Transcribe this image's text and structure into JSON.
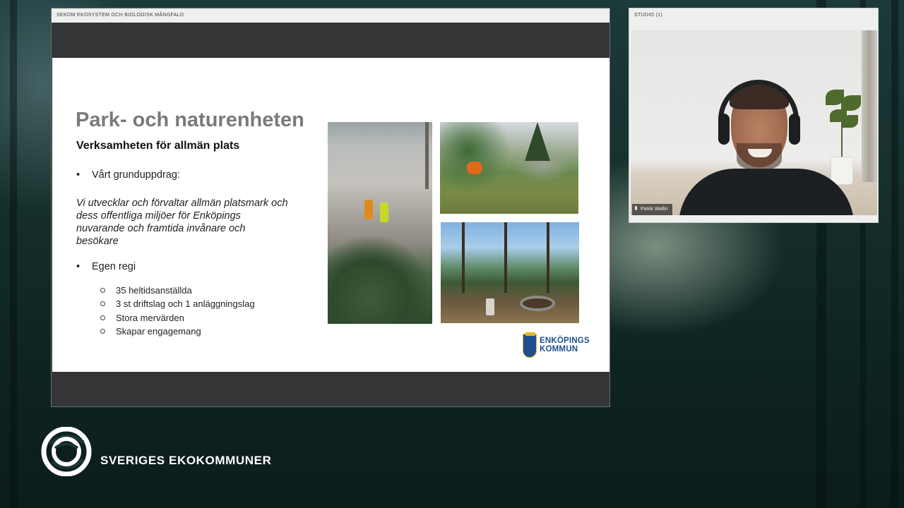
{
  "presentation": {
    "header_title": "SEKOM EKOSYSTEM OCH BIOLOGISK MÅNGFALD",
    "slide": {
      "title": "Park- och naturenheten",
      "subtitle": "Verksamheten för allmän plats",
      "bullet_1": "Vårt grunduppdrag:",
      "mission_text": "Vi utvecklar och förvaltar allmän platsmark och dess offentliga miljöer för Enköpings nuvarande och framtida invånare och besökare",
      "bullet_2": "Egen regi",
      "sub_items": [
        "35 heltidsanställda",
        "3 st driftslag och 1 anläggningslag",
        "Stora mervärden",
        "Skapar engagemang"
      ],
      "logo_line_1": "ENKÖPINGS",
      "logo_line_2": "KOMMUN"
    }
  },
  "studio": {
    "header_title": "STUDIO (1)",
    "participant_name": "Patrik Wallin"
  },
  "brand": {
    "name": "SVERIGES EKOKOMMUNER"
  }
}
